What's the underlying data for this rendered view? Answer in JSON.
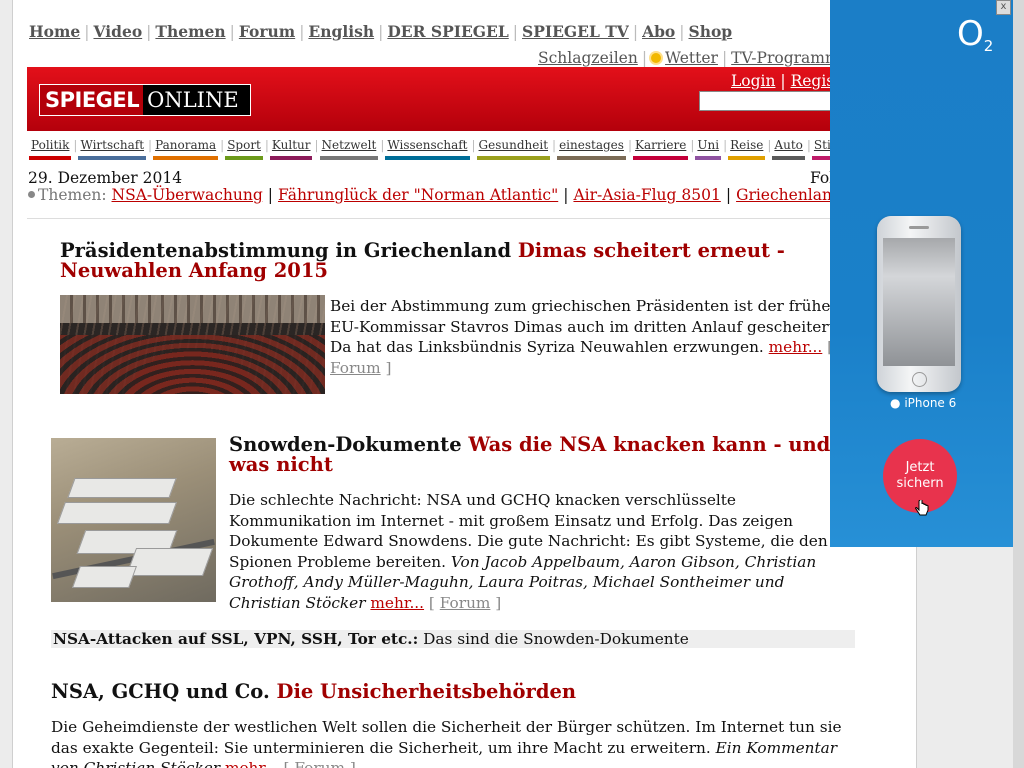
{
  "topnav": {
    "items": [
      "Home",
      "Video",
      "Themen",
      "Forum",
      "English",
      "DER SPIEGEL",
      "SPIEGEL TV",
      "Abo",
      "Shop"
    ]
  },
  "subnav": {
    "schlagzeilen": "Schlagzeilen",
    "wetter": "Wetter",
    "tv": "TV-Programm"
  },
  "header": {
    "logo_left": "SPIEGEL",
    "logo_right": "ONLINE",
    "login": "Login",
    "register": "Regist"
  },
  "ressorts": [
    "Politik",
    "Wirtschaft",
    "Panorama",
    "Sport",
    "Kultur",
    "Netzwelt",
    "Wissenschaft",
    "Gesundheit",
    "einestages",
    "Karriere",
    "Uni",
    "Reise",
    "Auto",
    "Stil"
  ],
  "ressort_colors": [
    "#cc0000",
    "#4a6e9b",
    "#e07000",
    "#6c9a1b",
    "#8c1b5a",
    "#777777",
    "#006e98",
    "#9aa01e",
    "#7b6b56",
    "#c4003a",
    "#8f52a1",
    "#e0a000",
    "#5b5b5b",
    "#bf1b69"
  ],
  "date": "29. Dezember 2014",
  "follow": "Folgen",
  "themes": {
    "label": "Themen:",
    "items": [
      "NSA-Überwachung",
      "Fährunglück der \"Norman Atlantic\"",
      "Air-Asia-Flug 8501",
      "Griechenland"
    ]
  },
  "article1": {
    "kicker": "Präsidentenabstimmung in Griechenland",
    "title": "Dimas scheitert erneut - Neuwahlen Anfang 2015",
    "teaser": "Bei der Abstimmung zum griechischen Präsidenten ist der frühere EU-Kommissar Stavros Dimas auch im dritten Anlauf gescheitert. Da hat das Linksbündnis Syriza Neuwahlen erzwungen.",
    "more": "mehr...",
    "forum": "Forum"
  },
  "article2": {
    "kicker": "Snowden-Dokumente",
    "title": "Was die NSA knacken kann - und was nicht",
    "teaser": "Die schlechte Nachricht: NSA und GCHQ knacken verschlüsselte Kommunikation im Internet - mit großem Einsatz und Erfolg. Das zeigen Dokumente Edward Snowdens. Die gute Nachricht: Es gibt Systeme, die den Spionen Probleme bereiten.",
    "authors": "Von Jacob Appelbaum, Aaron Gibson, Christian Grothoff, Andy Müller-Maguhn, Laura Poitras, Michael Sontheimer und Christian Stöcker",
    "more": "mehr...",
    "forum": "Forum"
  },
  "related": {
    "bold": "NSA-Attacken auf SSL, VPN, SSH, Tor etc.:",
    "text": "Das sind die Snowden-Dokumente"
  },
  "article3": {
    "kicker": "NSA, GCHQ und Co.",
    "title": "Die Unsicherheitsbehörden",
    "teaser": "Die Geheimdienste der westlichen Welt sollen die Sicherheit der Bürger schützen. Im Internet tun sie das exakte Gegenteil: Sie unterminieren die Sicherheit, um ihre Macht zu erweitern.",
    "authors": "Ein Kommentar von Christian Stöcker",
    "more": "mehr...",
    "forum": "Forum"
  },
  "ad": {
    "brand": "O",
    "brand_sub": "2",
    "model": "iPhone 6",
    "cta": "Jetzt sichern",
    "close": "x"
  },
  "colors": {
    "spiegel_red": "#c4000d",
    "headline_red": "#a00000",
    "ad_blue": "#1a80c9",
    "ad_button": "#e8334d"
  }
}
